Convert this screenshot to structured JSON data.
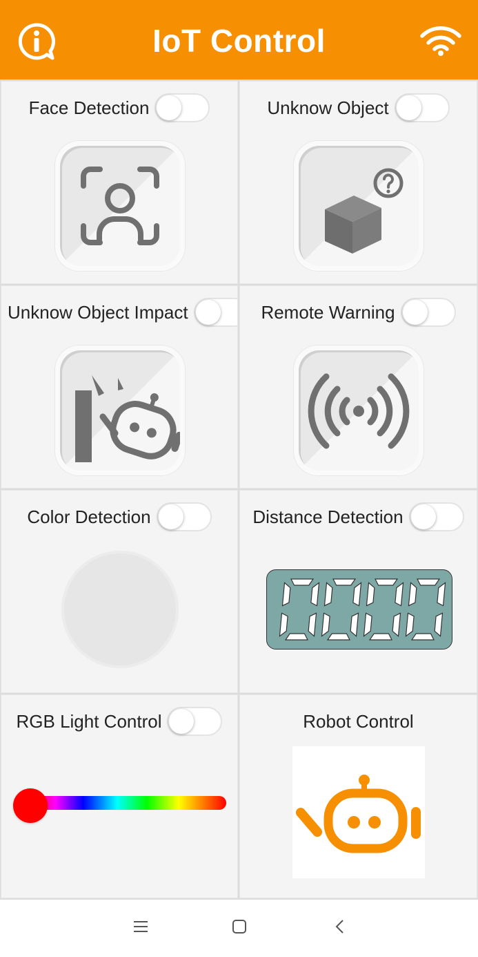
{
  "app": {
    "title": "IoT Control",
    "accent_color": "#f78f02",
    "left_icon": "info-icon",
    "right_icon": "wifi-icon"
  },
  "cells": [
    {
      "label": "Face Detection",
      "toggle": false,
      "icon": "face-scan-icon"
    },
    {
      "label": "Unknow Object",
      "toggle": false,
      "icon": "unknown-box-icon"
    },
    {
      "label": "Unknow Object Impact",
      "toggle": false,
      "icon": "robot-impact-icon"
    },
    {
      "label": "Remote Warning",
      "toggle": false,
      "icon": "signal-waves-icon"
    },
    {
      "label": "Color Detection",
      "toggle": false,
      "color_value": "#e6e6e6"
    },
    {
      "label": "Distance Detection",
      "toggle": false,
      "display": "0000",
      "display_color": "#7da8a5"
    },
    {
      "label": "RGB Light Control",
      "toggle": false,
      "slider_value": 0,
      "thumb_color": "#ff0000"
    },
    {
      "label": "Robot Control",
      "icon": "robot-icon"
    }
  ],
  "navbar": {
    "icons": [
      "menu-icon",
      "home-square-icon",
      "back-icon"
    ]
  }
}
